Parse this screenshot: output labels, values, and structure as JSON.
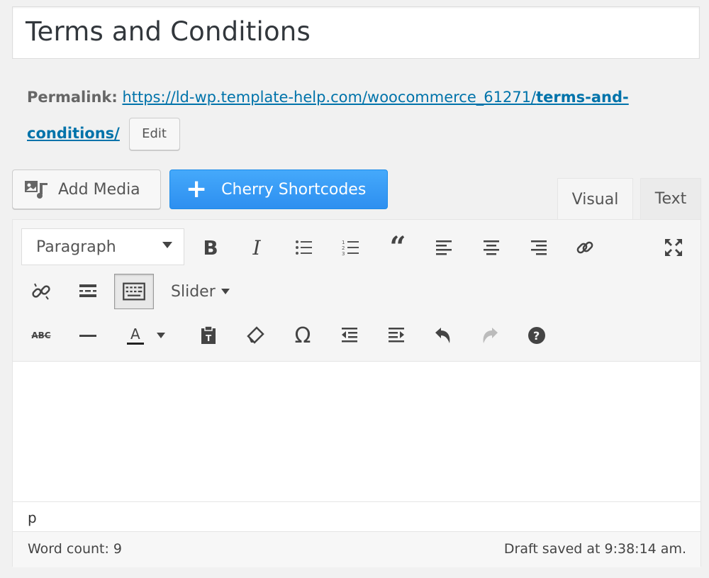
{
  "post": {
    "title": "Terms and Conditions"
  },
  "permalink": {
    "label": "Permalink:",
    "url_prefix": "https://ld-wp.template-help.com/woocommerce_61271/",
    "slug": "terms-and-conditions/",
    "edit_label": "Edit"
  },
  "media_buttons": {
    "add_media": "Add Media",
    "cherry_shortcodes": "Cherry Shortcodes"
  },
  "tabs": {
    "visual": "Visual",
    "text": "Text"
  },
  "toolbar": {
    "format_select": "Paragraph",
    "slider_label": "Slider"
  },
  "editor": {
    "path": "p",
    "word_count": "Word count: 9",
    "draft_saved": "Draft saved at 9:38:14 am."
  },
  "colors": {
    "link": "#0073aa",
    "primary_button": "#2d8ff0",
    "toolbar_bg": "#f5f5f5"
  }
}
